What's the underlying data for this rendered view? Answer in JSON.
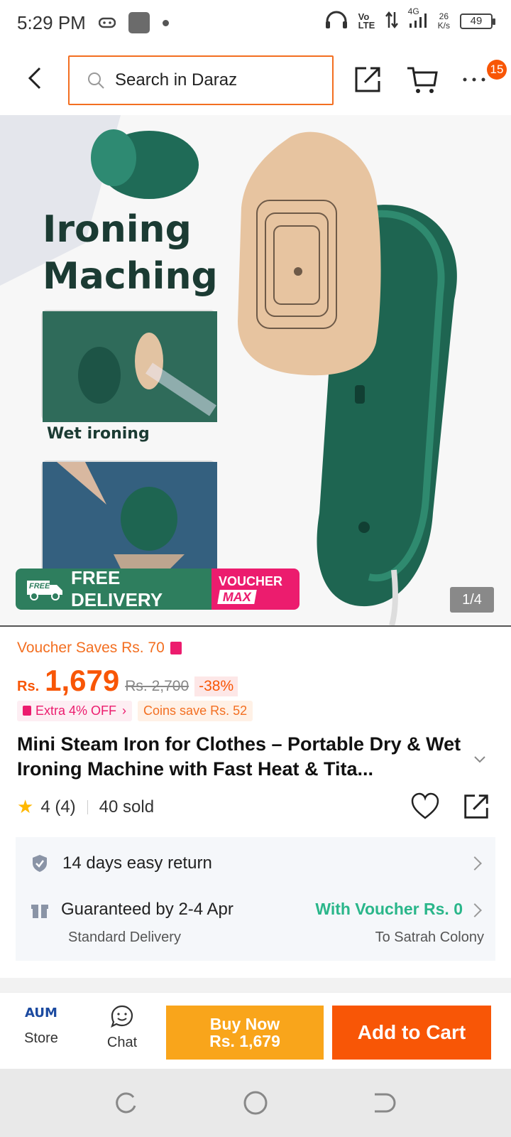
{
  "status_bar": {
    "time": "5:29 PM",
    "network": "4G",
    "net_speed": "26",
    "net_speed_unit": "K/s",
    "volte": "Vo LTE",
    "battery": "49"
  },
  "top_nav": {
    "search_placeholder": "Search in Daraz",
    "cart_badge": "15"
  },
  "hero": {
    "title_line1": "Ironing",
    "title_line2": "Maching",
    "thumb_caption": "Wet ironing",
    "free_delivery_tag": "FREE",
    "free_delivery": "FREE DELIVERY",
    "voucher": "VOUCHER",
    "voucher_max": "MAX",
    "pager": "1/4"
  },
  "product": {
    "voucher_saves": "Voucher Saves Rs. 70",
    "currency": "Rs.",
    "price": "1,679",
    "original_price": "Rs. 2,700",
    "discount": "-38%",
    "extra_off": "Extra 4% OFF",
    "coins_save": "Coins save Rs. 52",
    "title": "Mini Steam Iron for Clothes – Portable Dry & Wet Ironing Machine with Fast Heat & Tita...",
    "rating": "4 (4)",
    "sold": "40 sold"
  },
  "services": {
    "return_policy": "14 days easy return",
    "delivery_guarantee": "Guaranteed by 2-4 Apr",
    "delivery_type": "Standard Delivery",
    "delivery_voucher": "With Voucher Rs. 0",
    "location": "To Satrah Colony"
  },
  "action_bar": {
    "store_logo": "AUM",
    "store_label": "Store",
    "chat_label": "Chat",
    "buy_now_line1": "Buy Now",
    "buy_now_line2": "Rs. 1,679",
    "add_to_cart": "Add to Cart"
  },
  "colors": {
    "brand_orange": "#f85606",
    "buy_now": "#f9a51b",
    "voucher_green": "#2ab68a",
    "voucher_pink": "#ec1c6e"
  }
}
